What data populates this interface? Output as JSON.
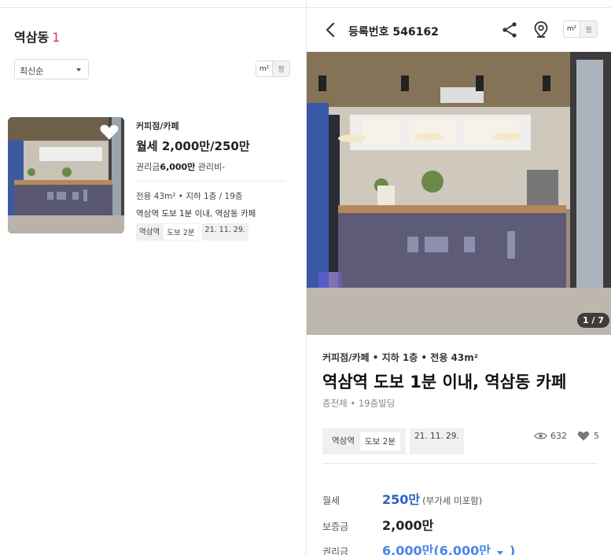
{
  "list": {
    "area_name": "역삼동",
    "count": "1",
    "sort": {
      "selected": "최신순"
    },
    "unit_toggle": {
      "sqm": "m²",
      "pyeong": "평"
    },
    "card": {
      "category": "커피점/카페",
      "price": "월세 2,000만/250만",
      "key_money_label": "권리금",
      "key_money_value": "6,000만",
      "maintenance": "관리비-",
      "spec": "전용 43m² • 지하 1층 / 19층",
      "description": "역삼역 도보 1분 이내, 역삼동 카페",
      "tags": {
        "station": "역삼역",
        "walk": "도보 2분",
        "date": "21. 11. 29."
      }
    }
  },
  "detail": {
    "title": "등록번호 546162",
    "unit_toggle": {
      "sqm": "m²",
      "pyeong": "평"
    },
    "photo_counter": "1 / 7",
    "meta": "커피점/카페 • 지하 1층 • 전용 43m²",
    "headline": "역삼역 도보 1분 이내, 역삼동 카페",
    "sub": "층전체 • 19층빌딩",
    "tags": {
      "station": "역삼역",
      "walk": "도보 2분",
      "date": "21. 11. 29."
    },
    "stats": {
      "views": "632",
      "likes": "5"
    },
    "prices": [
      {
        "label": "월세",
        "value": "250만",
        "note": "(부가세 미포함)"
      },
      {
        "label": "보증금",
        "value": "2,000만"
      },
      {
        "label": "권리금",
        "value": "6,000만(",
        "value2": "6,000만",
        "close": ")"
      }
    ]
  },
  "colors": {
    "accent_red": "#e53950",
    "price_blue": "#2d5fc4",
    "link_blue": "#4a86e8"
  }
}
